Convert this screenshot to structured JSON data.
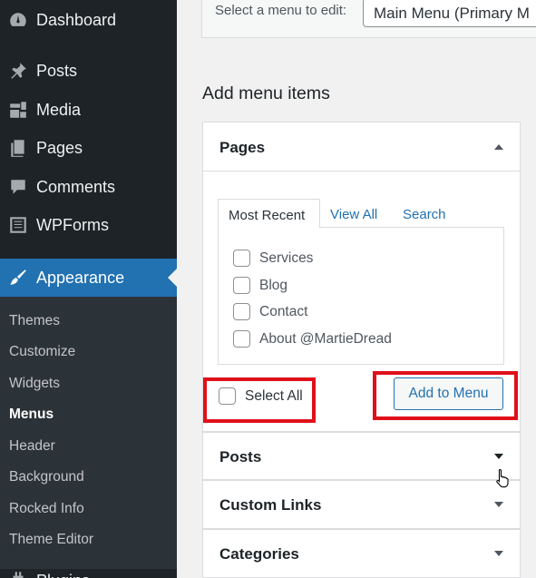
{
  "sidebar": {
    "items": [
      {
        "label": "Dashboard",
        "icon": "dashboard-icon"
      },
      {
        "label": "Posts",
        "icon": "pin-icon"
      },
      {
        "label": "Media",
        "icon": "media-icon"
      },
      {
        "label": "Pages",
        "icon": "pages-icon"
      },
      {
        "label": "Comments",
        "icon": "comment-icon"
      },
      {
        "label": "WPForms",
        "icon": "forms-icon"
      },
      {
        "label": "Appearance",
        "icon": "brush-icon"
      }
    ],
    "submenu": [
      "Themes",
      "Customize",
      "Widgets",
      "Menus",
      "Header",
      "Background",
      "Rocked Info",
      "Theme Editor"
    ],
    "current_submenu": "Menus",
    "next_partial": "Plugins"
  },
  "top": {
    "label": "Select a menu to edit:",
    "selected_menu": "Main Menu (Primary M"
  },
  "main": {
    "heading": "Add menu items",
    "pages_panel": {
      "title": "Pages",
      "tabs": [
        "Most Recent",
        "View All",
        "Search"
      ],
      "items": [
        "Services",
        "Blog",
        "Contact",
        "About @MartieDread"
      ],
      "select_all": "Select All",
      "add_button": "Add to Menu"
    },
    "other_panels": [
      "Posts",
      "Custom Links",
      "Categories"
    ]
  },
  "colors": {
    "accent": "#2271b1",
    "highlight": "#e0101a",
    "sidebar": "#1d2327"
  }
}
